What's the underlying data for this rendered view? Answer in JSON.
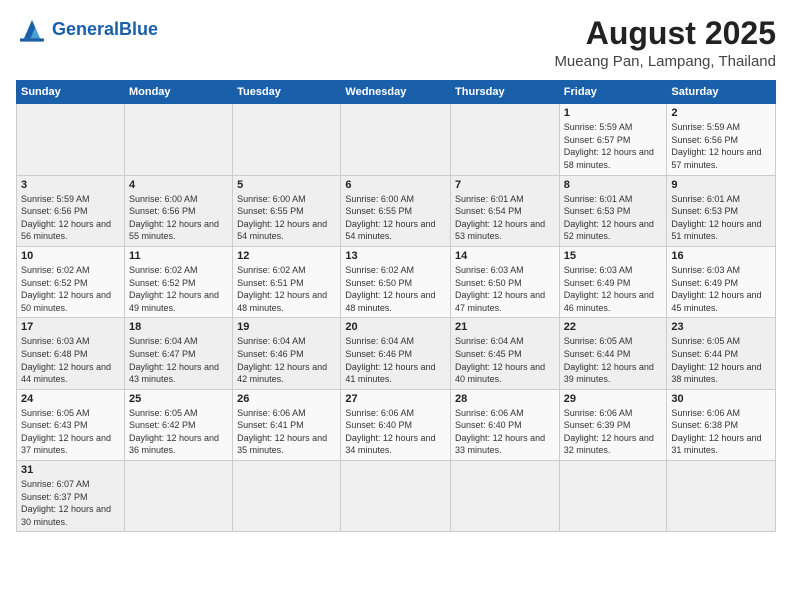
{
  "header": {
    "logo_general": "General",
    "logo_blue": "Blue",
    "month_year": "August 2025",
    "location": "Mueang Pan, Lampang, Thailand"
  },
  "days_of_week": [
    "Sunday",
    "Monday",
    "Tuesday",
    "Wednesday",
    "Thursday",
    "Friday",
    "Saturday"
  ],
  "weeks": [
    {
      "days": [
        {
          "num": "",
          "info": ""
        },
        {
          "num": "",
          "info": ""
        },
        {
          "num": "",
          "info": ""
        },
        {
          "num": "",
          "info": ""
        },
        {
          "num": "",
          "info": ""
        },
        {
          "num": "1",
          "info": "Sunrise: 5:59 AM\nSunset: 6:57 PM\nDaylight: 12 hours\nand 58 minutes."
        },
        {
          "num": "2",
          "info": "Sunrise: 5:59 AM\nSunset: 6:56 PM\nDaylight: 12 hours\nand 57 minutes."
        }
      ]
    },
    {
      "days": [
        {
          "num": "3",
          "info": "Sunrise: 5:59 AM\nSunset: 6:56 PM\nDaylight: 12 hours\nand 56 minutes."
        },
        {
          "num": "4",
          "info": "Sunrise: 6:00 AM\nSunset: 6:56 PM\nDaylight: 12 hours\nand 55 minutes."
        },
        {
          "num": "5",
          "info": "Sunrise: 6:00 AM\nSunset: 6:55 PM\nDaylight: 12 hours\nand 54 minutes."
        },
        {
          "num": "6",
          "info": "Sunrise: 6:00 AM\nSunset: 6:55 PM\nDaylight: 12 hours\nand 54 minutes."
        },
        {
          "num": "7",
          "info": "Sunrise: 6:01 AM\nSunset: 6:54 PM\nDaylight: 12 hours\nand 53 minutes."
        },
        {
          "num": "8",
          "info": "Sunrise: 6:01 AM\nSunset: 6:53 PM\nDaylight: 12 hours\nand 52 minutes."
        },
        {
          "num": "9",
          "info": "Sunrise: 6:01 AM\nSunset: 6:53 PM\nDaylight: 12 hours\nand 51 minutes."
        }
      ]
    },
    {
      "days": [
        {
          "num": "10",
          "info": "Sunrise: 6:02 AM\nSunset: 6:52 PM\nDaylight: 12 hours\nand 50 minutes."
        },
        {
          "num": "11",
          "info": "Sunrise: 6:02 AM\nSunset: 6:52 PM\nDaylight: 12 hours\nand 49 minutes."
        },
        {
          "num": "12",
          "info": "Sunrise: 6:02 AM\nSunset: 6:51 PM\nDaylight: 12 hours\nand 48 minutes."
        },
        {
          "num": "13",
          "info": "Sunrise: 6:02 AM\nSunset: 6:50 PM\nDaylight: 12 hours\nand 48 minutes."
        },
        {
          "num": "14",
          "info": "Sunrise: 6:03 AM\nSunset: 6:50 PM\nDaylight: 12 hours\nand 47 minutes."
        },
        {
          "num": "15",
          "info": "Sunrise: 6:03 AM\nSunset: 6:49 PM\nDaylight: 12 hours\nand 46 minutes."
        },
        {
          "num": "16",
          "info": "Sunrise: 6:03 AM\nSunset: 6:49 PM\nDaylight: 12 hours\nand 45 minutes."
        }
      ]
    },
    {
      "days": [
        {
          "num": "17",
          "info": "Sunrise: 6:03 AM\nSunset: 6:48 PM\nDaylight: 12 hours\nand 44 minutes."
        },
        {
          "num": "18",
          "info": "Sunrise: 6:04 AM\nSunset: 6:47 PM\nDaylight: 12 hours\nand 43 minutes."
        },
        {
          "num": "19",
          "info": "Sunrise: 6:04 AM\nSunset: 6:46 PM\nDaylight: 12 hours\nand 42 minutes."
        },
        {
          "num": "20",
          "info": "Sunrise: 6:04 AM\nSunset: 6:46 PM\nDaylight: 12 hours\nand 41 minutes."
        },
        {
          "num": "21",
          "info": "Sunrise: 6:04 AM\nSunset: 6:45 PM\nDaylight: 12 hours\nand 40 minutes."
        },
        {
          "num": "22",
          "info": "Sunrise: 6:05 AM\nSunset: 6:44 PM\nDaylight: 12 hours\nand 39 minutes."
        },
        {
          "num": "23",
          "info": "Sunrise: 6:05 AM\nSunset: 6:44 PM\nDaylight: 12 hours\nand 38 minutes."
        }
      ]
    },
    {
      "days": [
        {
          "num": "24",
          "info": "Sunrise: 6:05 AM\nSunset: 6:43 PM\nDaylight: 12 hours\nand 37 minutes."
        },
        {
          "num": "25",
          "info": "Sunrise: 6:05 AM\nSunset: 6:42 PM\nDaylight: 12 hours\nand 36 minutes."
        },
        {
          "num": "26",
          "info": "Sunrise: 6:06 AM\nSunset: 6:41 PM\nDaylight: 12 hours\nand 35 minutes."
        },
        {
          "num": "27",
          "info": "Sunrise: 6:06 AM\nSunset: 6:40 PM\nDaylight: 12 hours\nand 34 minutes."
        },
        {
          "num": "28",
          "info": "Sunrise: 6:06 AM\nSunset: 6:40 PM\nDaylight: 12 hours\nand 33 minutes."
        },
        {
          "num": "29",
          "info": "Sunrise: 6:06 AM\nSunset: 6:39 PM\nDaylight: 12 hours\nand 32 minutes."
        },
        {
          "num": "30",
          "info": "Sunrise: 6:06 AM\nSunset: 6:38 PM\nDaylight: 12 hours\nand 31 minutes."
        }
      ]
    },
    {
      "days": [
        {
          "num": "31",
          "info": "Sunrise: 6:07 AM\nSunset: 6:37 PM\nDaylight: 12 hours\nand 30 minutes."
        },
        {
          "num": "",
          "info": ""
        },
        {
          "num": "",
          "info": ""
        },
        {
          "num": "",
          "info": ""
        },
        {
          "num": "",
          "info": ""
        },
        {
          "num": "",
          "info": ""
        },
        {
          "num": "",
          "info": ""
        }
      ]
    }
  ]
}
